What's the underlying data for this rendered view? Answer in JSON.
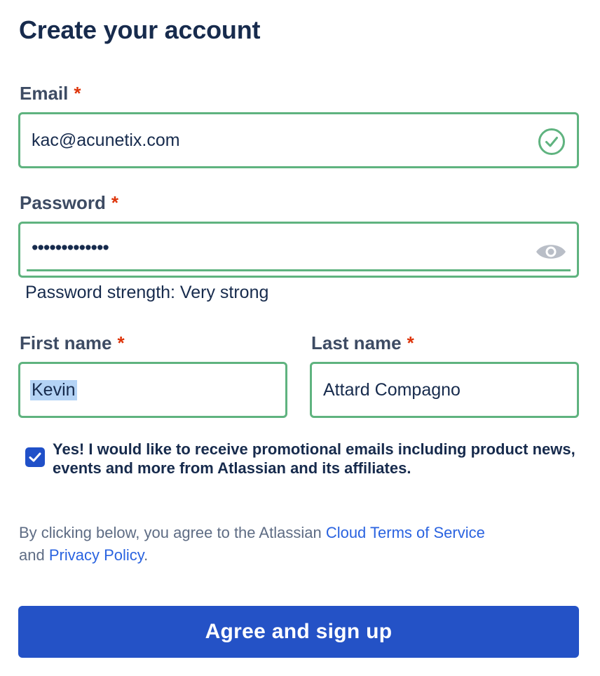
{
  "form": {
    "title": "Create your account",
    "required_marker": "*",
    "email": {
      "label": "Email",
      "value": "kac@acunetix.com",
      "valid": true
    },
    "password": {
      "label": "Password",
      "masked_value": "•••••••••••••",
      "strength_text": "Password strength: Very strong"
    },
    "first_name": {
      "label": "First name",
      "value": "Kevin"
    },
    "last_name": {
      "label": "Last name",
      "value": "Attard Compagno"
    },
    "marketing_consent": {
      "checked": true,
      "text": "Yes! I would like to receive promotional emails including product news, events and more from Atlassian and its affiliates."
    },
    "legal": {
      "prefix": "By clicking below, you agree to the Atlassian ",
      "terms_link": "Cloud Terms of Service",
      "middle": "and ",
      "privacy_link": "Privacy Policy",
      "suffix": "."
    },
    "submit_label": "Agree and sign up"
  },
  "icons": {
    "email_status": "check-circle-icon",
    "password_toggle": "eye-icon",
    "checkbox": "checkmark-icon"
  },
  "colors": {
    "valid_border": "#5fb37f",
    "required": "#de350b",
    "primary": "#2452c6",
    "link": "#2a63e0",
    "text": "#172b4d"
  }
}
